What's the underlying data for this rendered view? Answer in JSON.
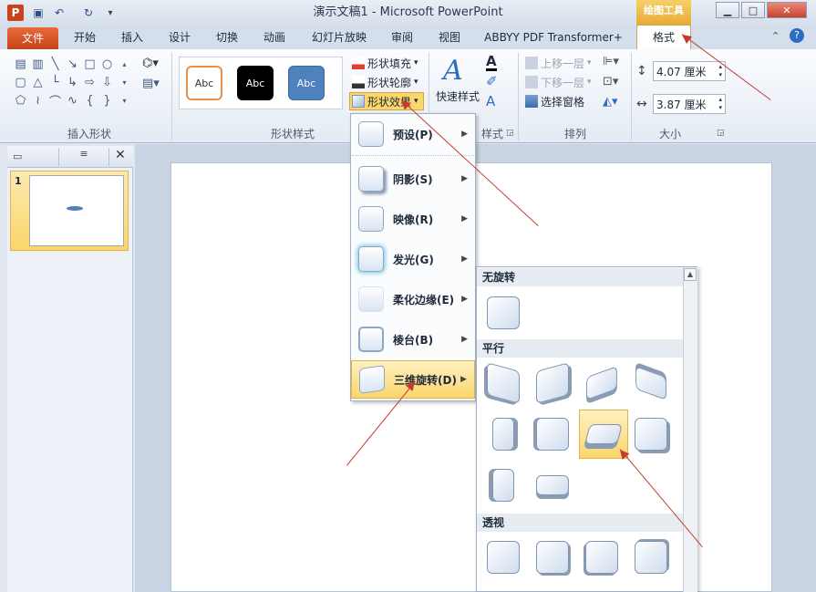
{
  "window": {
    "title": "演示文稿1 - Microsoft PowerPoint",
    "context_group": "绘图工具",
    "app_icon": "P"
  },
  "tabs": [
    "文件",
    "开始",
    "插入",
    "设计",
    "切换",
    "动画",
    "幻灯片放映",
    "审阅",
    "视图",
    "ABBYY PDF Transformer+",
    "格式"
  ],
  "ribbon": {
    "groups": {
      "insert_shapes": "插入形状",
      "shape_styles": "形状样式",
      "wordart": "样式",
      "arrange": "排列",
      "size": "大小"
    },
    "style_samples": [
      "Abc",
      "Abc",
      "Abc"
    ],
    "shape_fill": "形状填充",
    "shape_outline": "形状轮廓",
    "shape_effects": "形状效果",
    "quick_styles": "快速样式",
    "bring_forward": "上移一层",
    "send_backward": "下移一层",
    "selection_pane": "选择窗格",
    "height": "4.07 厘米",
    "width": "3.87 厘米"
  },
  "slides_panel": {
    "slide_number": "1"
  },
  "effects_menu": {
    "items": [
      {
        "label": "预设(P)"
      },
      {
        "label": "阴影(S)"
      },
      {
        "label": "映像(R)"
      },
      {
        "label": "发光(G)"
      },
      {
        "label": "柔化边缘(E)"
      },
      {
        "label": "棱台(B)"
      },
      {
        "label": "三维旋转(D)"
      }
    ]
  },
  "rotation_gallery": {
    "no_rotation": "无旋转",
    "parallel": "平行",
    "perspective": "透视"
  },
  "colors": {
    "file_tab": "#d0501f",
    "context_tab": "#f0b94c",
    "highlight": "#fbd66b",
    "annotation_arrow": "#c43a2e"
  }
}
